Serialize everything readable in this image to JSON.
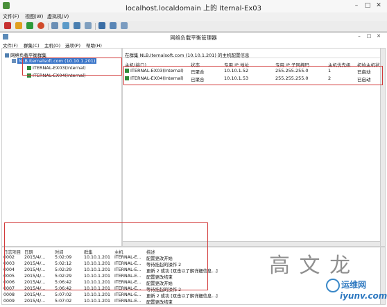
{
  "window": {
    "title": "localhost.localdomain 上的 Iternal-Ex03"
  },
  "vm_menu": [
    "文件(F)",
    "视图(W)",
    "虚拟机(V)"
  ],
  "toolbar": {
    "icons": [
      "stop-icon",
      "pause-icon",
      "play-icon",
      "refresh-icon",
      "snapshot-icon",
      "revert-icon",
      "manage-snapshot-icon",
      "settings-icon",
      "send-keys-icon",
      "fullscreen-icon",
      "network-icon"
    ]
  },
  "app": {
    "title": "网络负载平衡管理器"
  },
  "app_menu": [
    "文件(F)",
    "群集(C)",
    "主机(O)",
    "选项(P)",
    "帮助(H)"
  ],
  "tree": {
    "root": "网络负载平衡群集",
    "cluster": "NLB.Iternalsoft.com (10.10.1.201)",
    "hosts": [
      "ITERNAL-EX03(Internal)",
      "ITERNAL-EX04(Internal)"
    ]
  },
  "details": {
    "header": "在群集 NLB.Iternalsoft.com (10.10.1.201) 的主机配置信息",
    "columns": [
      "主机(接口)",
      "状态",
      "专用 IP 地址",
      "专用 IP 子网掩码",
      "主机优先级",
      "初始主机状态"
    ],
    "rows": [
      [
        "ITERNAL-EX03(Internal)",
        "已聚合",
        "10.10.1.52",
        "255.255.255.0",
        "1",
        "已启动"
      ],
      [
        "ITERNAL-EX04(Internal)",
        "已聚合",
        "10.10.1.53",
        "255.255.255.0",
        "2",
        "已启动"
      ]
    ]
  },
  "log": {
    "columns": [
      "日志项目",
      "日期",
      "时间",
      "群集",
      "主机",
      "描述"
    ],
    "rows": [
      [
        "0002",
        "2015/4/...",
        "5:02:09",
        "10.10.1.201",
        "ITERNAL-E...",
        "配置更改开始"
      ],
      [
        "0003",
        "2015/4/...",
        "5:02:12",
        "10.10.1.201",
        "ITERNAL-E...",
        "等待挂起的操作 2"
      ],
      [
        "0004",
        "2015/4/...",
        "5:02:29",
        "10.10.1.201",
        "ITERNAL-E...",
        "更新 2 成功 [双击以了解详细信息...]"
      ],
      [
        "0005",
        "2015/4/...",
        "5:02:29",
        "10.10.1.201",
        "ITERNAL-E...",
        "配置更改结束"
      ],
      [
        "0006",
        "2015/4/...",
        "5:06:42",
        "10.10.1.201",
        "ITERNAL-E...",
        "配置更改开始"
      ],
      [
        "0007",
        "2015/4/...",
        "5:06:42",
        "10.10.1.201",
        "ITERNAL-E...",
        "等待挂起的操作 2"
      ],
      [
        "0008",
        "2015/4/...",
        "5:07:02",
        "10.10.1.201",
        "ITERNAL-E...",
        "更新 2 成功 [双击以了解详细信息...]"
      ],
      [
        "0009",
        "2015/4/...",
        "5:07:02",
        "10.10.1.201",
        "ITERNAL-E...",
        "配置更改结束"
      ]
    ]
  },
  "watermark": {
    "text": "高 文 龙"
  },
  "logo": {
    "cn": "运维网",
    "en": "iyunv.com"
  },
  "colors": {
    "highlight": "#3874c8",
    "annotation_red": "#d23a3a",
    "status_green": "#2f8a3a"
  }
}
